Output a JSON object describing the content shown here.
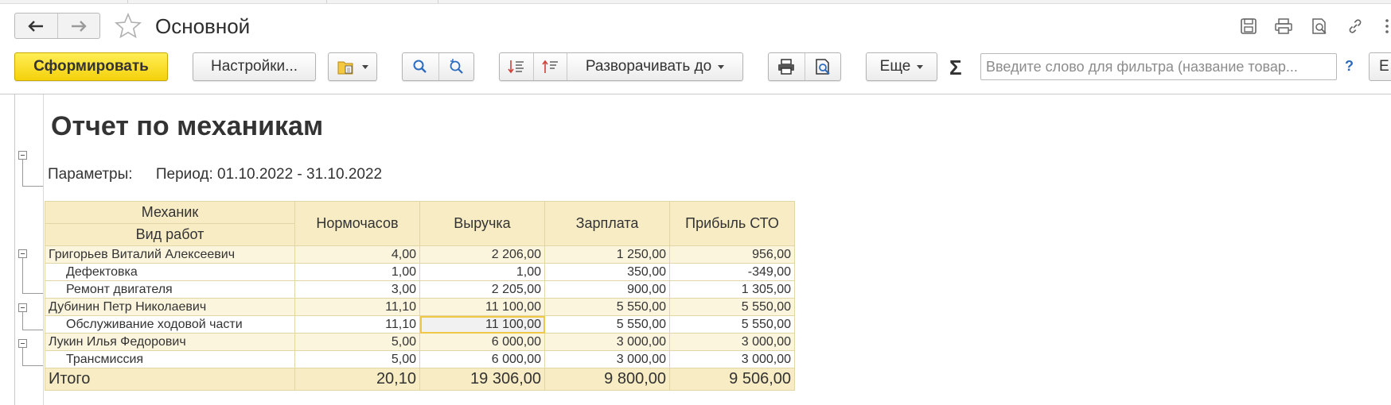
{
  "header": {
    "title": "Основной"
  },
  "toolbar": {
    "generate_label": "Сформировать",
    "settings_label": "Настройки...",
    "expand_label": "Разворачивать до",
    "more_label": "Еще",
    "sigma": "Σ",
    "filter_placeholder": "Введите слово для фильтра (название товар...",
    "help_label": "?",
    "last_button_label": "Е"
  },
  "report": {
    "title": "Отчет по механикам",
    "params_label": "Параметры:",
    "period_text": "Период: 01.10.2022 - 31.10.2022",
    "columns": {
      "mechanic": "Механик",
      "work_type": "Вид работ",
      "hours": "Нормочасов",
      "revenue": "Выручка",
      "salary": "Зарплата",
      "profit": "Прибыль СТО"
    },
    "rows": [
      {
        "name": "Григорьев Виталий Алексеевич",
        "hours": "4,00",
        "revenue": "2 206,00",
        "salary": "1 250,00",
        "profit": "956,00"
      },
      {
        "name": "Дефектовка",
        "hours": "1,00",
        "revenue": "1,00",
        "salary": "350,00",
        "profit": "-349,00"
      },
      {
        "name": "Ремонт двигателя",
        "hours": "3,00",
        "revenue": "2 205,00",
        "salary": "900,00",
        "profit": "1 305,00"
      },
      {
        "name": "Дубинин Петр Николаевич",
        "hours": "11,10",
        "revenue": "11 100,00",
        "salary": "5 550,00",
        "profit": "5 550,00"
      },
      {
        "name": "Обслуживание ходовой части",
        "hours": "11,10",
        "revenue": "11 100,00",
        "salary": "5 550,00",
        "profit": "5 550,00"
      },
      {
        "name": "Лукин Илья Федорович",
        "hours": "5,00",
        "revenue": "6 000,00",
        "salary": "3 000,00",
        "profit": "3 000,00"
      },
      {
        "name": "Трансмиссия",
        "hours": "5,00",
        "revenue": "6 000,00",
        "salary": "3 000,00",
        "profit": "3 000,00"
      }
    ],
    "total": {
      "label": "Итого",
      "hours": "20,10",
      "revenue": "19 306,00",
      "salary": "9 800,00",
      "profit": "9 506,00"
    }
  },
  "colors": {
    "accent_yellow": "#f4d10c",
    "table_header_bg": "#f7ecc4",
    "selected_cell_border": "#f0c848"
  }
}
